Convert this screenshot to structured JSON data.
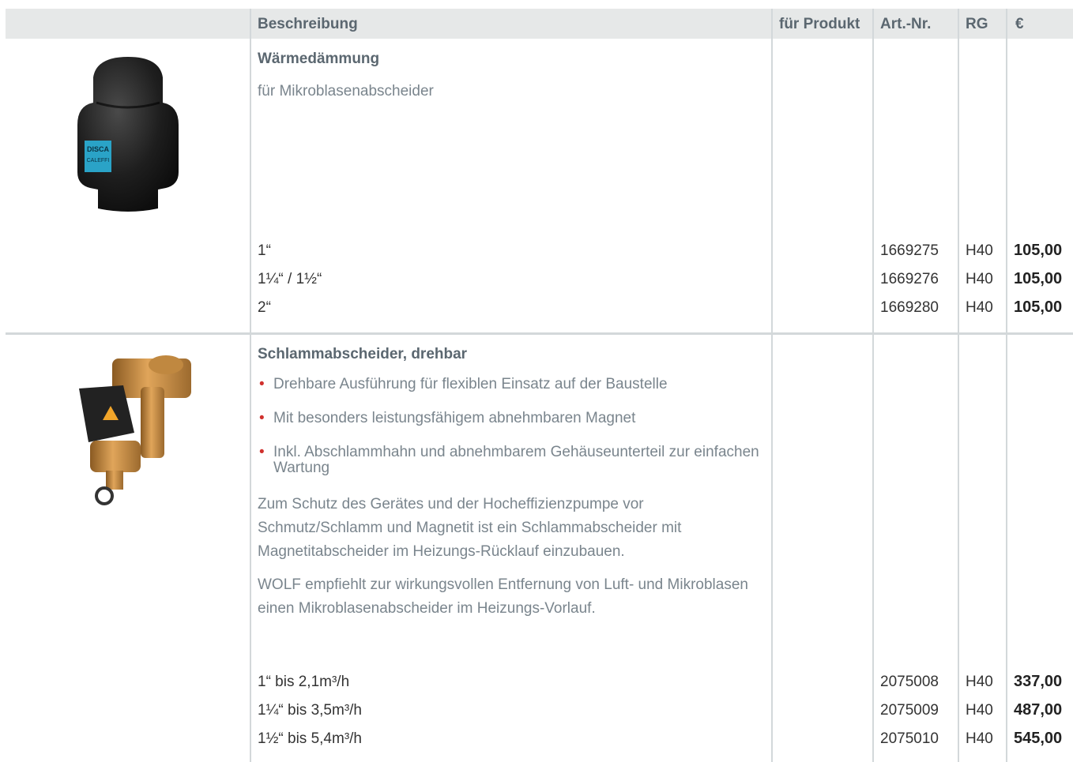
{
  "header": {
    "beschreibung": "Beschreibung",
    "fuer_produkt": "für Produkt",
    "art_nr": "Art.-Nr.",
    "rg": "RG",
    "currency": "€"
  },
  "products": [
    {
      "title": "Wärmedämmung",
      "subtitle": "für Mikroblasenabscheider",
      "image_logo_text": [
        "DISCA",
        "CALEFFI"
      ],
      "rows": [
        {
          "desc": "1“",
          "art_nr": "1669275",
          "rg": "H40",
          "price": "105,00"
        },
        {
          "desc": "1¼“ / 1½“",
          "art_nr": "1669276",
          "rg": "H40",
          "price": "105,00"
        },
        {
          "desc": "2“",
          "art_nr": "1669280",
          "rg": "H40",
          "price": "105,00"
        }
      ]
    },
    {
      "title": "Schlammabscheider, drehbar",
      "bullets": [
        "Drehbare Ausführung für flexiblen Einsatz auf der Baustelle",
        "Mit besonders leistungsfähigem abnehmbaren Magnet",
        "Inkl. Abschlammhahn und abnehmbarem Gehäuseunterteil zur einfachen Wartung"
      ],
      "paragraphs": [
        "Zum Schutz des Gerätes und der Hocheffizienzpumpe vor Schmutz/Schlamm und Magnetit ist ein Schlammabscheider mit Magnetitabscheider im Heizungs-Rücklauf einzubauen.",
        "WOLF empfiehlt zur wirkungsvollen Entfernung von Luft- und Mikroblasen einen Mikroblasenabscheider im Heizungs-Vorlauf."
      ],
      "rows": [
        {
          "desc": "1“ bis 2,1m³/h",
          "art_nr": "2075008",
          "rg": "H40",
          "price": "337,00"
        },
        {
          "desc": "1¼“ bis 3,5m³/h",
          "art_nr": "2075009",
          "rg": "H40",
          "price": "487,00"
        },
        {
          "desc": "1½“ bis 5,4m³/h",
          "art_nr": "2075010",
          "rg": "H40",
          "price": "545,00"
        }
      ]
    }
  ],
  "colors": {
    "header_bg": "#e6e8e8",
    "header_text": "#5b6770",
    "grid_lines": "#d3d8da",
    "bullet_dot": "#d0312d"
  }
}
